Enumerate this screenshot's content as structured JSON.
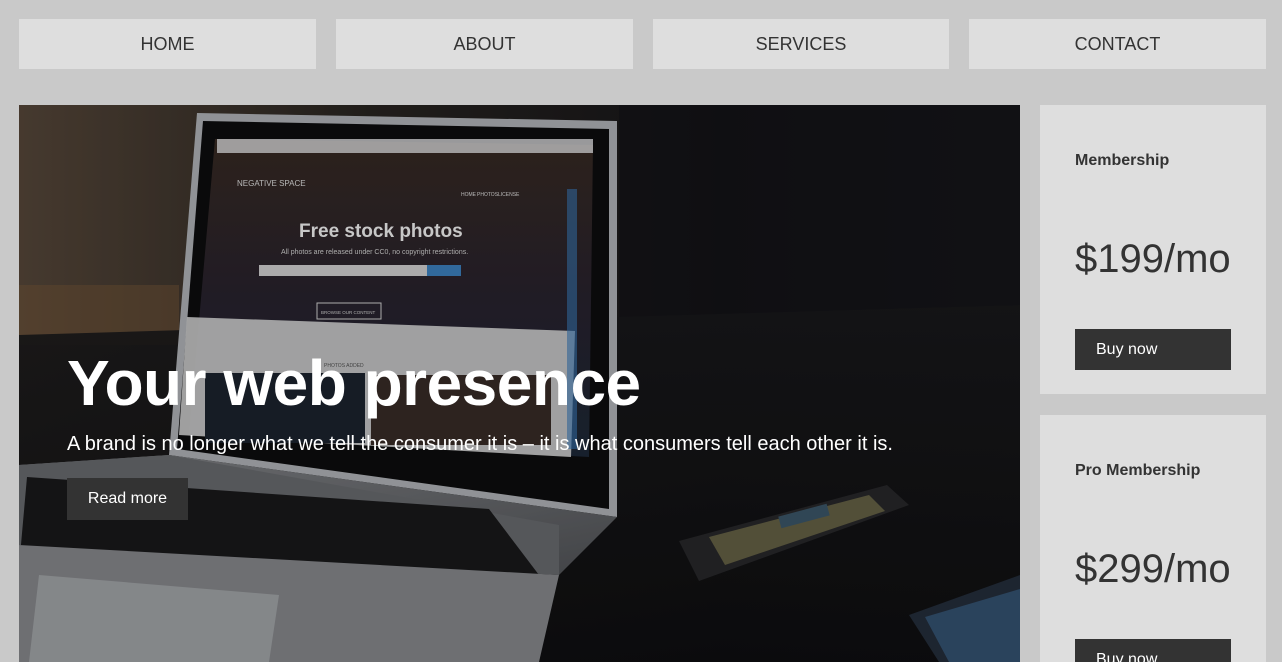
{
  "nav": {
    "items": [
      {
        "label": "HOME"
      },
      {
        "label": "ABOUT"
      },
      {
        "label": "SERVICES"
      },
      {
        "label": "CONTACT"
      }
    ]
  },
  "hero": {
    "title": "Your web presence",
    "text": "A brand is no longer what we tell the consumer it is – it is what consumers tell each other it is.",
    "button_label": "Read more",
    "laptop_screen": {
      "site_name": "NEGATIVE SPACE",
      "nav_items": [
        "HOME",
        "PHOTOS",
        "LICENSE"
      ],
      "heading": "Free stock photos",
      "subheading": "All photos are released under CC0, no copyright restrictions.",
      "button_label": "BROWSE OUR CONTENT",
      "section_label": "PHOTOS ADDED"
    }
  },
  "plans": [
    {
      "name": "Membership",
      "price": "$199/mo",
      "button_label": "Buy now"
    },
    {
      "name": "Pro Membership",
      "price": "$299/mo",
      "button_label": "Buy now"
    }
  ],
  "colors": {
    "page_background": "#c9c9c9",
    "panel_background": "#dedede",
    "button_background": "#333333",
    "text_dark": "#333333",
    "text_light": "#ffffff"
  }
}
